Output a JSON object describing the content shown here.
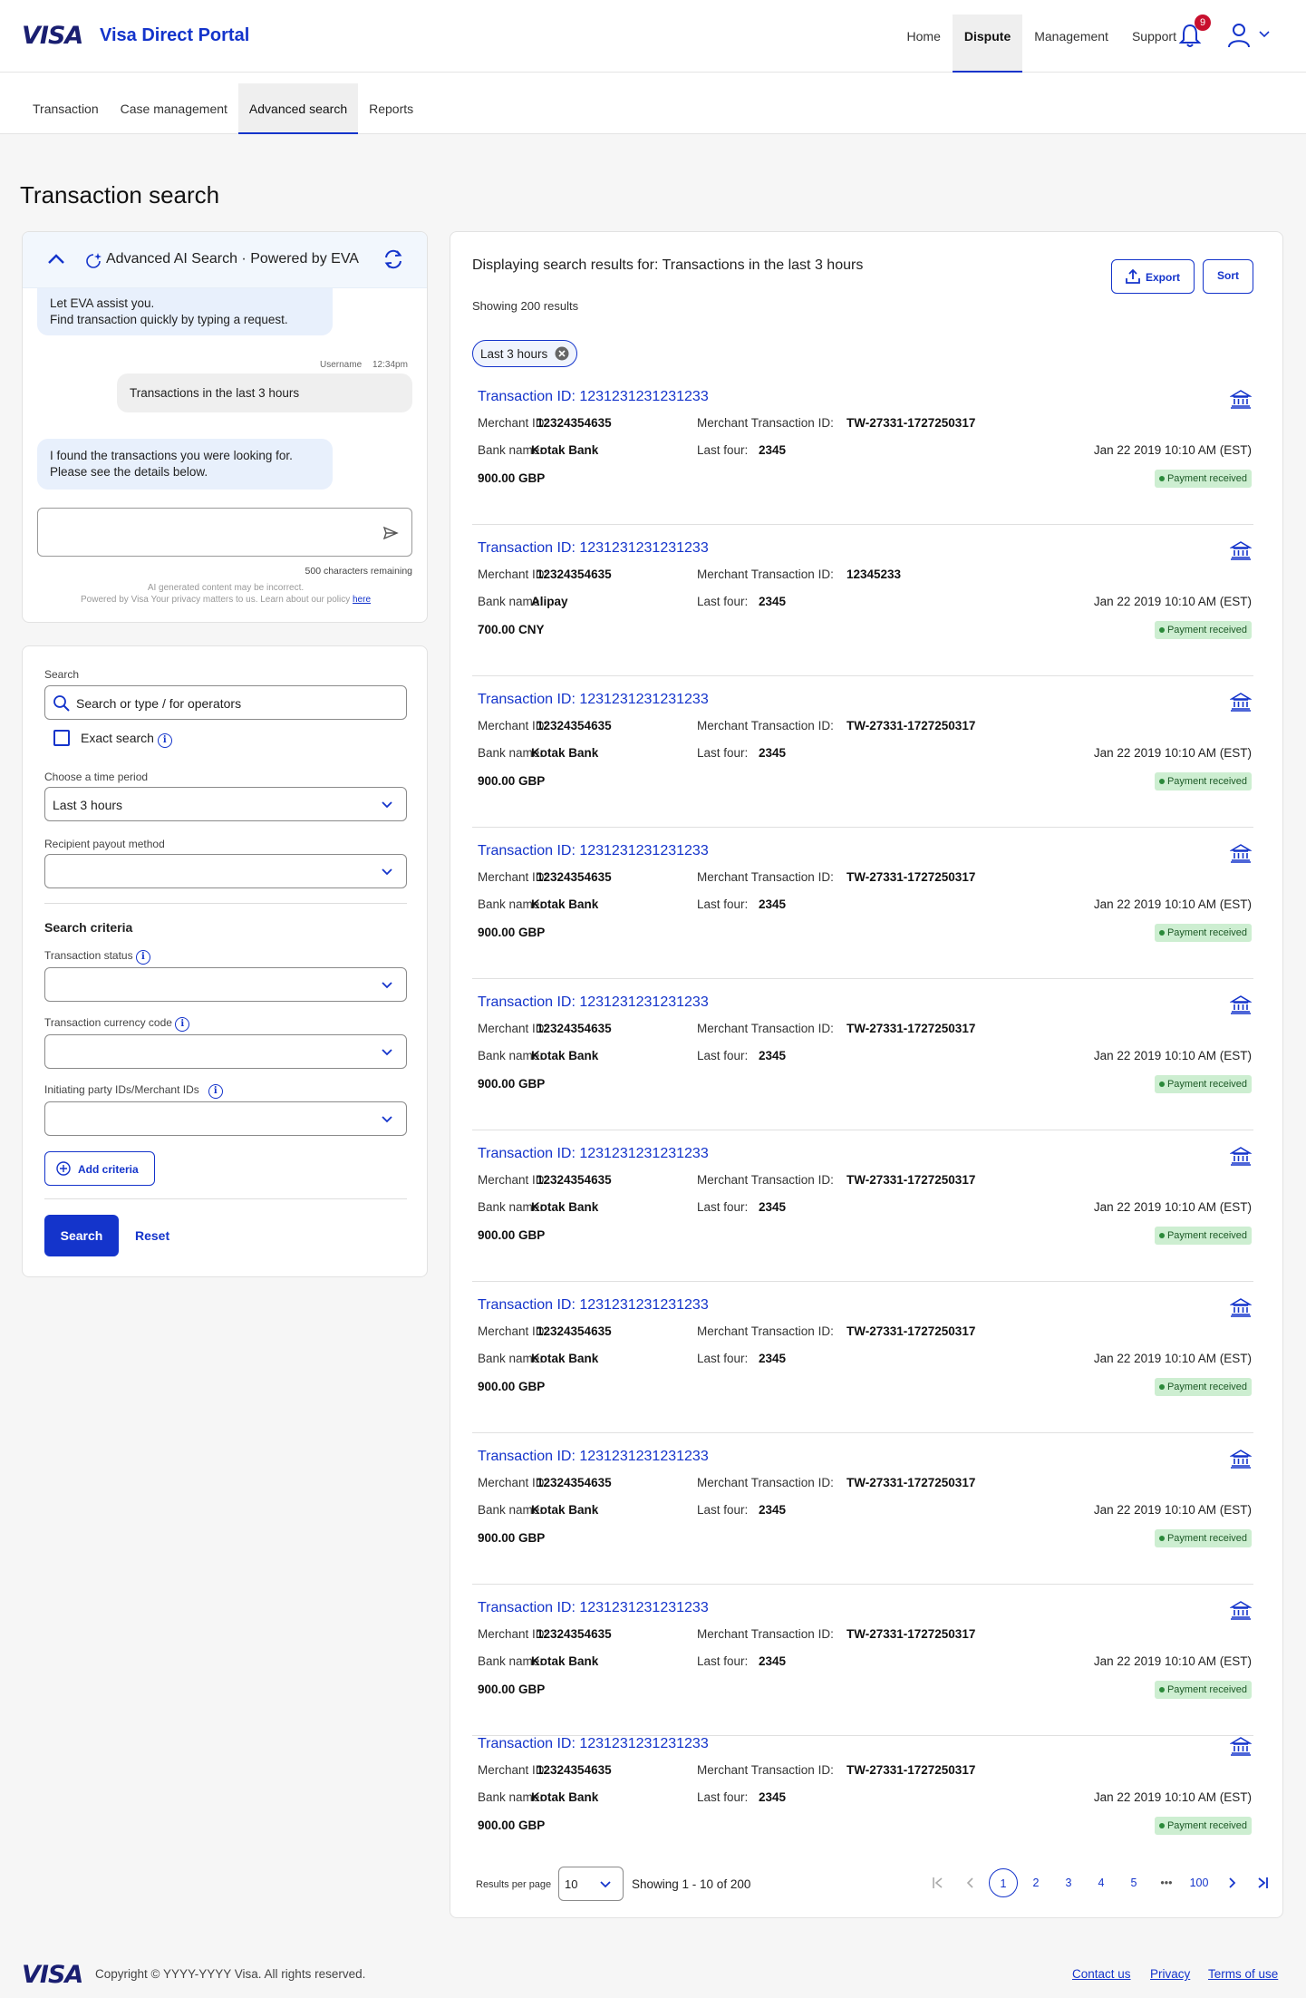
{
  "header": {
    "logo": "VISA",
    "app_title": "Visa Direct Portal",
    "nav": [
      "Home",
      "Dispute",
      "Management",
      "Support"
    ],
    "active_nav": "Dispute",
    "notification_count": "9"
  },
  "subnav": {
    "items": [
      "Transaction",
      "Case management",
      "Advanced search",
      "Reports"
    ],
    "active": "Advanced search"
  },
  "page_title": "Transaction search",
  "ai_panel": {
    "title": "Advanced AI Search · Powered by EVA",
    "greeting_line1": "Let EVA assist you.",
    "greeting_line2": "Find transaction quickly by typing a request.",
    "user_meta_name": "Username",
    "user_meta_time": "12:34pm",
    "user_message": "Transactions in the last 3 hours",
    "reply_line1": "I found the transactions you were looking for.",
    "reply_line2": "Please see the details below.",
    "input_value": "",
    "chars_remaining": "500 characters remaining",
    "disclaimer_line1": "AI generated content may be incorrect.",
    "disclaimer_line2": "Powered by Visa Your privacy matters to us. Learn about our policy",
    "disclaimer_link": "here"
  },
  "search_form": {
    "search_label": "Search",
    "search_placeholder": "Search or type / for operators",
    "exact_search_label": "Exact search",
    "exact_search_checked": false,
    "time_period_label": "Choose a time period",
    "time_period_value": "Last 3 hours",
    "payout_method_label": "Recipient payout method",
    "payout_method_value": "",
    "criteria_title": "Search criteria",
    "status_label": "Transaction status",
    "status_value": "",
    "currency_label": "Transaction currency code",
    "currency_value": "",
    "party_label": "Initiating party IDs/Merchant IDs",
    "party_value": "",
    "add_criteria": "Add criteria",
    "search_button": "Search",
    "reset_button": "Reset"
  },
  "results": {
    "heading": "Displaying search results for: Transactions in the last 3 hours",
    "count_text": "Showing 200 results",
    "export_label": "Export",
    "sort_label": "Sort",
    "filter_chip": "Last 3 hours",
    "labels": {
      "merchant_id": "Merchant ID:",
      "merchant_txn_id": "Merchant Transaction ID:",
      "bank_name": "Bank name:",
      "last_four": "Last four:"
    },
    "transactions": [
      {
        "id": "Transaction ID: 1231231231231233",
        "merchant_id": "12324354635",
        "merchant_txn_id": "TW-27331-1727250317",
        "bank": "Kotak Bank",
        "last_four": "2345",
        "date": "Jan 22 2019 10:10 AM (EST)",
        "amount": "900.00 GBP",
        "status": "Payment received"
      },
      {
        "id": "Transaction ID: 1231231231231233",
        "merchant_id": "12324354635",
        "merchant_txn_id": "12345233",
        "bank": "Alipay",
        "last_four": "2345",
        "date": "Jan 22 2019 10:10 AM (EST)",
        "amount": "700.00 CNY",
        "status": "Payment received"
      },
      {
        "id": "Transaction ID: 1231231231231233",
        "merchant_id": "12324354635",
        "merchant_txn_id": "TW-27331-1727250317",
        "bank": "Kotak Bank",
        "last_four": "2345",
        "date": "Jan 22 2019 10:10 AM (EST)",
        "amount": "900.00 GBP",
        "status": "Payment received"
      },
      {
        "id": "Transaction ID: 1231231231231233",
        "merchant_id": "12324354635",
        "merchant_txn_id": "TW-27331-1727250317",
        "bank": "Kotak Bank",
        "last_four": "2345",
        "date": "Jan 22 2019 10:10 AM (EST)",
        "amount": "900.00 GBP",
        "status": "Payment received"
      },
      {
        "id": "Transaction ID: 1231231231231233",
        "merchant_id": "12324354635",
        "merchant_txn_id": "TW-27331-1727250317",
        "bank": "Kotak Bank",
        "last_four": "2345",
        "date": "Jan 22 2019 10:10 AM (EST)",
        "amount": "900.00 GBP",
        "status": "Payment received"
      },
      {
        "id": "Transaction ID: 1231231231231233",
        "merchant_id": "12324354635",
        "merchant_txn_id": "TW-27331-1727250317",
        "bank": "Kotak Bank",
        "last_four": "2345",
        "date": "Jan 22 2019 10:10 AM (EST)",
        "amount": "900.00 GBP",
        "status": "Payment received"
      },
      {
        "id": "Transaction ID: 1231231231231233",
        "merchant_id": "12324354635",
        "merchant_txn_id": "TW-27331-1727250317",
        "bank": "Kotak Bank",
        "last_four": "2345",
        "date": "Jan 22 2019 10:10 AM (EST)",
        "amount": "900.00 GBP",
        "status": "Payment received"
      },
      {
        "id": "Transaction ID: 1231231231231233",
        "merchant_id": "12324354635",
        "merchant_txn_id": "TW-27331-1727250317",
        "bank": "Kotak Bank",
        "last_four": "2345",
        "date": "Jan 22 2019 10:10 AM (EST)",
        "amount": "900.00 GBP",
        "status": "Payment received"
      },
      {
        "id": "Transaction ID: 1231231231231233",
        "merchant_id": "12324354635",
        "merchant_txn_id": "TW-27331-1727250317",
        "bank": "Kotak Bank",
        "last_four": "2345",
        "date": "Jan 22 2019 10:10 AM (EST)",
        "amount": "900.00 GBP",
        "status": "Payment received"
      },
      {
        "id": "Transaction ID: 1231231231231233",
        "merchant_id": "12324354635",
        "merchant_txn_id": "TW-27331-1727250317",
        "bank": "Kotak Bank",
        "last_four": "2345",
        "date": "Jan 22 2019 10:10 AM (EST)",
        "amount": "900.00 GBP",
        "status": "Payment received"
      }
    ],
    "pagination": {
      "rpp_label": "Results per page",
      "rpp_value": "10",
      "showing": "Showing 1 - 10 of 200",
      "pages": [
        "1",
        "2",
        "3",
        "4",
        "5"
      ],
      "ellipsis": "•••",
      "last_page": "100",
      "current": "1"
    }
  },
  "footer": {
    "logo": "VISA",
    "copyright": "Copyright © YYYY-YYYY Visa. All rights reserved.",
    "links": [
      "Contact us",
      "Privacy",
      "Terms of use"
    ]
  },
  "colors": {
    "brand_blue": "#1434cb",
    "visa_navy": "#1a1f71",
    "status_green_bg": "#cdeed1",
    "badge_red": "#c8102e"
  }
}
